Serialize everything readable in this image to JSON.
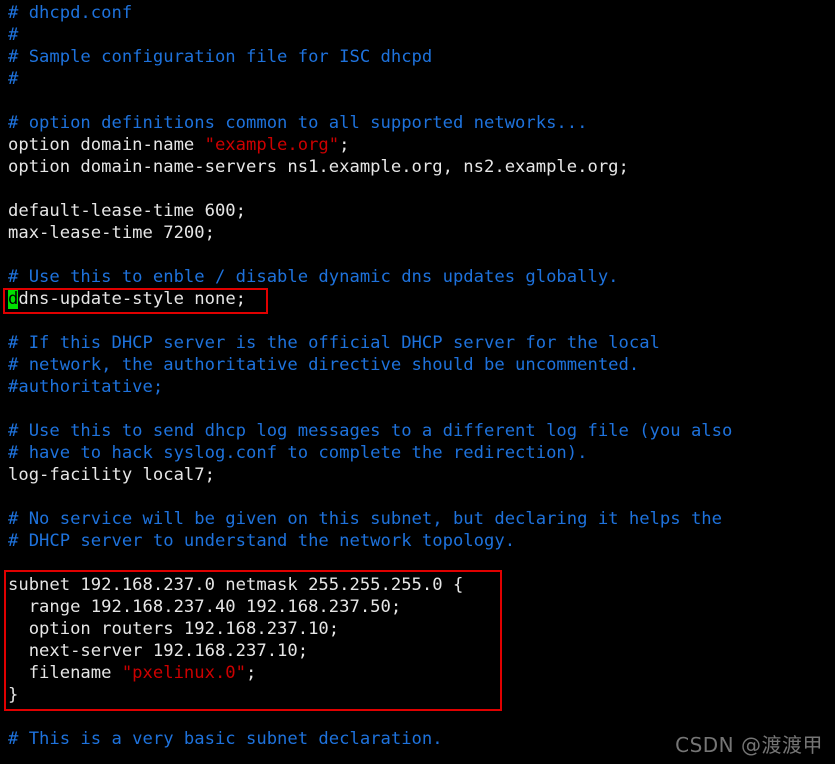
{
  "terminal": {
    "filename": "dhcpd.conf",
    "background_color": "#000000",
    "comment_color": "#1e72dc",
    "text_color": "#e6e6e6",
    "string_color": "#cc0000",
    "cursor_color": "#00e000",
    "annotation_color": "#e00000",
    "lines": [
      {
        "type": "comment",
        "text": "# dhcpd.conf"
      },
      {
        "type": "comment",
        "text": "#"
      },
      {
        "type": "comment",
        "text": "# Sample configuration file for ISC dhcpd"
      },
      {
        "type": "comment",
        "text": "#"
      },
      {
        "type": "blank",
        "text": ""
      },
      {
        "type": "comment",
        "text": "# option definitions common to all supported networks..."
      },
      {
        "type": "mixed_string",
        "prefix": "option domain-name ",
        "string": "\"example.org\"",
        "suffix": ";"
      },
      {
        "type": "plain",
        "text": "option domain-name-servers ns1.example.org, ns2.example.org;"
      },
      {
        "type": "blank",
        "text": ""
      },
      {
        "type": "plain",
        "text": "default-lease-time 600;"
      },
      {
        "type": "plain",
        "text": "max-lease-time 7200;"
      },
      {
        "type": "blank",
        "text": ""
      },
      {
        "type": "comment",
        "text": "# Use this to enble / disable dynamic dns updates globally."
      },
      {
        "type": "cursor_line",
        "cursor_char": "d",
        "rest": "dns-update-style none;"
      },
      {
        "type": "blank",
        "text": ""
      },
      {
        "type": "comment",
        "text": "# If this DHCP server is the official DHCP server for the local"
      },
      {
        "type": "comment",
        "text": "# network, the authoritative directive should be uncommented."
      },
      {
        "type": "comment",
        "text": "#authoritative;"
      },
      {
        "type": "blank",
        "text": ""
      },
      {
        "type": "comment",
        "text": "# Use this to send dhcp log messages to a different log file (you also"
      },
      {
        "type": "comment",
        "text": "# have to hack syslog.conf to complete the redirection)."
      },
      {
        "type": "plain",
        "text": "log-facility local7;"
      },
      {
        "type": "blank",
        "text": ""
      },
      {
        "type": "comment",
        "text": "# No service will be given on this subnet, but declaring it helps the"
      },
      {
        "type": "comment",
        "text": "# DHCP server to understand the network topology."
      },
      {
        "type": "blank",
        "text": ""
      },
      {
        "type": "plain",
        "text": "subnet 192.168.237.0 netmask 255.255.255.0 {"
      },
      {
        "type": "plain",
        "text": "  range 192.168.237.40 192.168.237.50;"
      },
      {
        "type": "plain",
        "text": "  option routers 192.168.237.10;"
      },
      {
        "type": "plain",
        "text": "  next-server 192.168.237.10;"
      },
      {
        "type": "mixed_string",
        "prefix": "  filename ",
        "string": "\"pxelinux.0\"",
        "suffix": ";"
      },
      {
        "type": "plain",
        "text": "}"
      },
      {
        "type": "blank",
        "text": ""
      },
      {
        "type": "comment",
        "text": "# This is a very basic subnet declaration."
      }
    ]
  },
  "annotations": {
    "ddns_box_label": "ddns-update-style-highlight",
    "subnet_box_label": "subnet-block-highlight"
  },
  "watermark": {
    "text": "CSDN @渡渡甲"
  }
}
